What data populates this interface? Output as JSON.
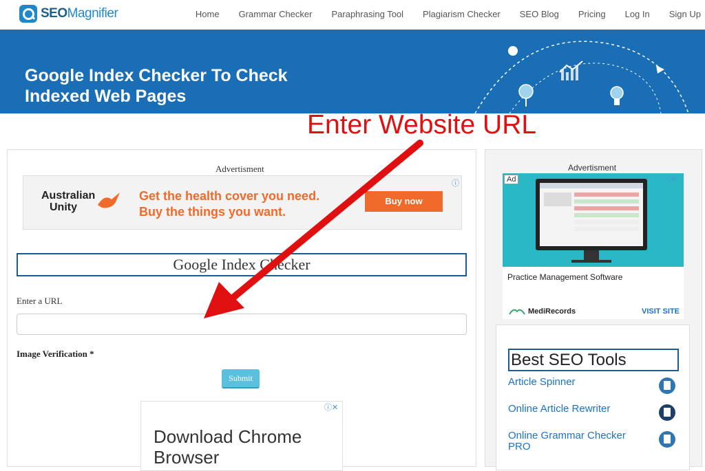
{
  "brand": {
    "logo_prefix": "SEO",
    "logo_suffix": "Magnifier"
  },
  "nav": [
    "Home",
    "Grammar Checker",
    "Paraphrasing Tool",
    "Plagiarism Checker",
    "SEO Blog",
    "Pricing",
    "Log In",
    "Sign Up"
  ],
  "hero": {
    "title_line1": "Google Index Checker To Check",
    "title_line2": "Indexed Web Pages"
  },
  "annotation": {
    "text": "Enter Website URL"
  },
  "main": {
    "ad_label": "Advertisment",
    "banner_ad": {
      "brand_line1": "Australian",
      "brand_line2": "Unity",
      "headline_line1": "Get the health cover you need.",
      "headline_line2": "Buy the things you want.",
      "cta": "Buy now"
    },
    "tool_title": "Google Index Checker",
    "url_label": "Enter a URL",
    "url_value": "",
    "verification_label": "Image Verification *",
    "submit_label": "Submit",
    "bottom_ad": {
      "text_line1": "Download Chrome",
      "text_line2": "Browser"
    }
  },
  "sidebar": {
    "ad_label": "Advertisment",
    "ad": {
      "tag": "Ad",
      "title": "Practice Management Software",
      "brand": "MediRecords",
      "cta": "VISIT SITE"
    },
    "tools_title": "Best SEO Tools",
    "tools": [
      "Article Spinner",
      "Online Article Rewriter",
      "Online Grammar Checker PRO"
    ]
  },
  "colors": {
    "hero_bg": "#1a6eb5",
    "accent": "#1e88c9",
    "annotation": "#e01010",
    "ad_orange": "#f06a2b",
    "submit": "#5bc0de"
  }
}
